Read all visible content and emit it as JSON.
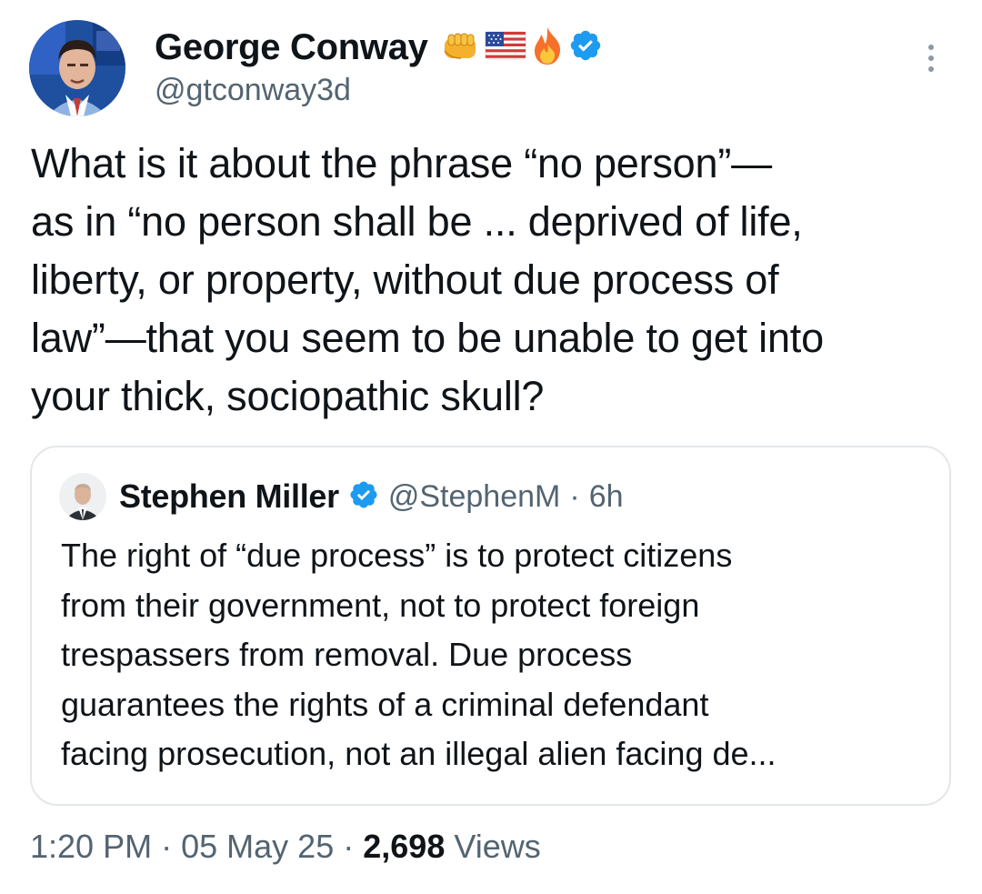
{
  "author": {
    "display_name": "George Conway",
    "emojis": [
      "fist-emoji",
      "us-flag-emoji",
      "fire-emoji"
    ],
    "verified_icon": "verified-badge-icon",
    "handle": "@gtconway3d"
  },
  "tweet": {
    "text": "What is it about the phrase “no person”—\nas in “no person shall be ... deprived of life,\nliberty, or property, without due process of\nlaw”—that you seem to be unable to get into\nyour thick, sociopathic skull?"
  },
  "quote": {
    "display_name": "Stephen Miller",
    "handle": "@StephenM",
    "separator": "·",
    "time": "6h",
    "text": "The right of “due process” is to protect citizens\nfrom their government, not to protect foreign\ntrespassers from removal. Due process\nguarantees the rights of a criminal defendant\nfacing prosecution, not an illegal alien facing de..."
  },
  "meta": {
    "time": "1:20 PM",
    "sep1": "·",
    "date": "05 May 25",
    "sep2": "·",
    "views_count": "2,698",
    "views_label": "Views"
  },
  "colors": {
    "text": "#0f1419",
    "secondary": "#536471",
    "verified": "#1d9bf0",
    "border": "#e3e7ea"
  }
}
